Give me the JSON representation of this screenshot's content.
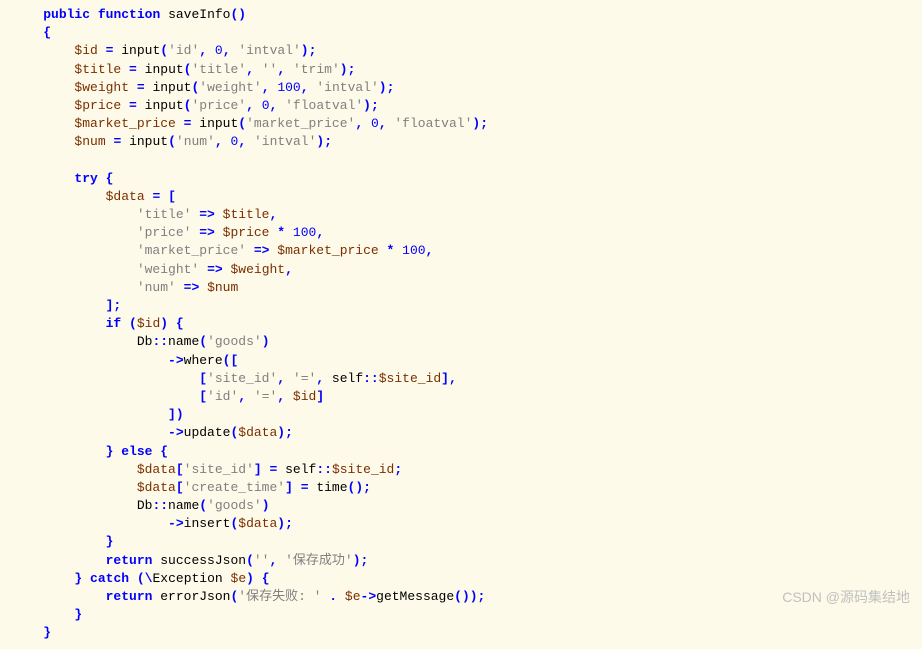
{
  "code": {
    "lines": [
      {
        "indent": 1,
        "segments": [
          {
            "c": "kw",
            "t": "public"
          },
          {
            "c": "plain",
            "t": " "
          },
          {
            "c": "kw",
            "t": "function"
          },
          {
            "c": "plain",
            "t": " saveInfo"
          },
          {
            "c": "punct",
            "t": "()"
          }
        ]
      },
      {
        "indent": 1,
        "segments": [
          {
            "c": "punct",
            "t": "{"
          }
        ]
      },
      {
        "indent": 2,
        "segments": [
          {
            "c": "var",
            "t": "$id"
          },
          {
            "c": "plain",
            "t": " "
          },
          {
            "c": "op",
            "t": "="
          },
          {
            "c": "plain",
            "t": " input"
          },
          {
            "c": "punct",
            "t": "("
          },
          {
            "c": "str",
            "t": "'id'"
          },
          {
            "c": "punct",
            "t": ","
          },
          {
            "c": "plain",
            "t": " "
          },
          {
            "c": "num",
            "t": "0"
          },
          {
            "c": "punct",
            "t": ","
          },
          {
            "c": "plain",
            "t": " "
          },
          {
            "c": "str",
            "t": "'intval'"
          },
          {
            "c": "punct",
            "t": ");"
          }
        ]
      },
      {
        "indent": 2,
        "segments": [
          {
            "c": "var",
            "t": "$title"
          },
          {
            "c": "plain",
            "t": " "
          },
          {
            "c": "op",
            "t": "="
          },
          {
            "c": "plain",
            "t": " input"
          },
          {
            "c": "punct",
            "t": "("
          },
          {
            "c": "str",
            "t": "'title'"
          },
          {
            "c": "punct",
            "t": ","
          },
          {
            "c": "plain",
            "t": " "
          },
          {
            "c": "str",
            "t": "''"
          },
          {
            "c": "punct",
            "t": ","
          },
          {
            "c": "plain",
            "t": " "
          },
          {
            "c": "str",
            "t": "'trim'"
          },
          {
            "c": "punct",
            "t": ");"
          }
        ]
      },
      {
        "indent": 2,
        "segments": [
          {
            "c": "var",
            "t": "$weight"
          },
          {
            "c": "plain",
            "t": " "
          },
          {
            "c": "op",
            "t": "="
          },
          {
            "c": "plain",
            "t": " input"
          },
          {
            "c": "punct",
            "t": "("
          },
          {
            "c": "str",
            "t": "'weight'"
          },
          {
            "c": "punct",
            "t": ","
          },
          {
            "c": "plain",
            "t": " "
          },
          {
            "c": "num",
            "t": "100"
          },
          {
            "c": "punct",
            "t": ","
          },
          {
            "c": "plain",
            "t": " "
          },
          {
            "c": "str",
            "t": "'intval'"
          },
          {
            "c": "punct",
            "t": ");"
          }
        ]
      },
      {
        "indent": 2,
        "segments": [
          {
            "c": "var",
            "t": "$price"
          },
          {
            "c": "plain",
            "t": " "
          },
          {
            "c": "op",
            "t": "="
          },
          {
            "c": "plain",
            "t": " input"
          },
          {
            "c": "punct",
            "t": "("
          },
          {
            "c": "str",
            "t": "'price'"
          },
          {
            "c": "punct",
            "t": ","
          },
          {
            "c": "plain",
            "t": " "
          },
          {
            "c": "num",
            "t": "0"
          },
          {
            "c": "punct",
            "t": ","
          },
          {
            "c": "plain",
            "t": " "
          },
          {
            "c": "str",
            "t": "'floatval'"
          },
          {
            "c": "punct",
            "t": ");"
          }
        ]
      },
      {
        "indent": 2,
        "segments": [
          {
            "c": "var",
            "t": "$market_price"
          },
          {
            "c": "plain",
            "t": " "
          },
          {
            "c": "op",
            "t": "="
          },
          {
            "c": "plain",
            "t": " input"
          },
          {
            "c": "punct",
            "t": "("
          },
          {
            "c": "str",
            "t": "'market_price'"
          },
          {
            "c": "punct",
            "t": ","
          },
          {
            "c": "plain",
            "t": " "
          },
          {
            "c": "num",
            "t": "0"
          },
          {
            "c": "punct",
            "t": ","
          },
          {
            "c": "plain",
            "t": " "
          },
          {
            "c": "str",
            "t": "'floatval'"
          },
          {
            "c": "punct",
            "t": ");"
          }
        ]
      },
      {
        "indent": 2,
        "segments": [
          {
            "c": "var",
            "t": "$num"
          },
          {
            "c": "plain",
            "t": " "
          },
          {
            "c": "op",
            "t": "="
          },
          {
            "c": "plain",
            "t": " input"
          },
          {
            "c": "punct",
            "t": "("
          },
          {
            "c": "str",
            "t": "'num'"
          },
          {
            "c": "punct",
            "t": ","
          },
          {
            "c": "plain",
            "t": " "
          },
          {
            "c": "num",
            "t": "0"
          },
          {
            "c": "punct",
            "t": ","
          },
          {
            "c": "plain",
            "t": " "
          },
          {
            "c": "str",
            "t": "'intval'"
          },
          {
            "c": "punct",
            "t": ");"
          }
        ]
      },
      {
        "indent": 0,
        "segments": []
      },
      {
        "indent": 2,
        "segments": [
          {
            "c": "kw",
            "t": "try"
          },
          {
            "c": "plain",
            "t": " "
          },
          {
            "c": "punct",
            "t": "{"
          }
        ]
      },
      {
        "indent": 3,
        "segments": [
          {
            "c": "var",
            "t": "$data"
          },
          {
            "c": "plain",
            "t": " "
          },
          {
            "c": "op",
            "t": "="
          },
          {
            "c": "plain",
            "t": " "
          },
          {
            "c": "punct",
            "t": "["
          }
        ]
      },
      {
        "indent": 4,
        "segments": [
          {
            "c": "str",
            "t": "'title'"
          },
          {
            "c": "plain",
            "t": " "
          },
          {
            "c": "op",
            "t": "=>"
          },
          {
            "c": "plain",
            "t": " "
          },
          {
            "c": "var",
            "t": "$title"
          },
          {
            "c": "punct",
            "t": ","
          }
        ]
      },
      {
        "indent": 4,
        "segments": [
          {
            "c": "str",
            "t": "'price'"
          },
          {
            "c": "plain",
            "t": " "
          },
          {
            "c": "op",
            "t": "=>"
          },
          {
            "c": "plain",
            "t": " "
          },
          {
            "c": "var",
            "t": "$price"
          },
          {
            "c": "plain",
            "t": " "
          },
          {
            "c": "op",
            "t": "*"
          },
          {
            "c": "plain",
            "t": " "
          },
          {
            "c": "num",
            "t": "100"
          },
          {
            "c": "punct",
            "t": ","
          }
        ]
      },
      {
        "indent": 4,
        "segments": [
          {
            "c": "str",
            "t": "'market_price'"
          },
          {
            "c": "plain",
            "t": " "
          },
          {
            "c": "op",
            "t": "=>"
          },
          {
            "c": "plain",
            "t": " "
          },
          {
            "c": "var",
            "t": "$market_price"
          },
          {
            "c": "plain",
            "t": " "
          },
          {
            "c": "op",
            "t": "*"
          },
          {
            "c": "plain",
            "t": " "
          },
          {
            "c": "num",
            "t": "100"
          },
          {
            "c": "punct",
            "t": ","
          }
        ]
      },
      {
        "indent": 4,
        "segments": [
          {
            "c": "str",
            "t": "'weight'"
          },
          {
            "c": "plain",
            "t": " "
          },
          {
            "c": "op",
            "t": "=>"
          },
          {
            "c": "plain",
            "t": " "
          },
          {
            "c": "var",
            "t": "$weight"
          },
          {
            "c": "punct",
            "t": ","
          }
        ]
      },
      {
        "indent": 4,
        "segments": [
          {
            "c": "str",
            "t": "'num'"
          },
          {
            "c": "plain",
            "t": " "
          },
          {
            "c": "op",
            "t": "=>"
          },
          {
            "c": "plain",
            "t": " "
          },
          {
            "c": "var",
            "t": "$num"
          }
        ]
      },
      {
        "indent": 3,
        "segments": [
          {
            "c": "punct",
            "t": "];"
          }
        ]
      },
      {
        "indent": 3,
        "segments": [
          {
            "c": "kw",
            "t": "if"
          },
          {
            "c": "plain",
            "t": " "
          },
          {
            "c": "punct",
            "t": "("
          },
          {
            "c": "var",
            "t": "$id"
          },
          {
            "c": "punct",
            "t": ")"
          },
          {
            "c": "plain",
            "t": " "
          },
          {
            "c": "punct",
            "t": "{"
          }
        ]
      },
      {
        "indent": 4,
        "segments": [
          {
            "c": "plain",
            "t": "Db"
          },
          {
            "c": "op",
            "t": "::"
          },
          {
            "c": "plain",
            "t": "name"
          },
          {
            "c": "punct",
            "t": "("
          },
          {
            "c": "str",
            "t": "'goods'"
          },
          {
            "c": "punct",
            "t": ")"
          }
        ]
      },
      {
        "indent": 5,
        "segments": [
          {
            "c": "op",
            "t": "->"
          },
          {
            "c": "plain",
            "t": "where"
          },
          {
            "c": "punct",
            "t": "(["
          }
        ]
      },
      {
        "indent": 6,
        "segments": [
          {
            "c": "punct",
            "t": "["
          },
          {
            "c": "str",
            "t": "'site_id'"
          },
          {
            "c": "punct",
            "t": ","
          },
          {
            "c": "plain",
            "t": " "
          },
          {
            "c": "str",
            "t": "'='"
          },
          {
            "c": "punct",
            "t": ","
          },
          {
            "c": "plain",
            "t": " self"
          },
          {
            "c": "op",
            "t": "::"
          },
          {
            "c": "var",
            "t": "$site_id"
          },
          {
            "c": "punct",
            "t": "],"
          }
        ]
      },
      {
        "indent": 6,
        "segments": [
          {
            "c": "punct",
            "t": "["
          },
          {
            "c": "str",
            "t": "'id'"
          },
          {
            "c": "punct",
            "t": ","
          },
          {
            "c": "plain",
            "t": " "
          },
          {
            "c": "str",
            "t": "'='"
          },
          {
            "c": "punct",
            "t": ","
          },
          {
            "c": "plain",
            "t": " "
          },
          {
            "c": "var",
            "t": "$id"
          },
          {
            "c": "punct",
            "t": "]"
          }
        ]
      },
      {
        "indent": 5,
        "segments": [
          {
            "c": "punct",
            "t": "])"
          }
        ]
      },
      {
        "indent": 5,
        "segments": [
          {
            "c": "op",
            "t": "->"
          },
          {
            "c": "plain",
            "t": "update"
          },
          {
            "c": "punct",
            "t": "("
          },
          {
            "c": "var",
            "t": "$data"
          },
          {
            "c": "punct",
            "t": ");"
          }
        ]
      },
      {
        "indent": 3,
        "segments": [
          {
            "c": "punct",
            "t": "}"
          },
          {
            "c": "plain",
            "t": " "
          },
          {
            "c": "kw",
            "t": "else"
          },
          {
            "c": "plain",
            "t": " "
          },
          {
            "c": "punct",
            "t": "{"
          }
        ]
      },
      {
        "indent": 4,
        "segments": [
          {
            "c": "var",
            "t": "$data"
          },
          {
            "c": "punct",
            "t": "["
          },
          {
            "c": "str",
            "t": "'site_id'"
          },
          {
            "c": "punct",
            "t": "]"
          },
          {
            "c": "plain",
            "t": " "
          },
          {
            "c": "op",
            "t": "="
          },
          {
            "c": "plain",
            "t": " self"
          },
          {
            "c": "op",
            "t": "::"
          },
          {
            "c": "var",
            "t": "$site_id"
          },
          {
            "c": "punct",
            "t": ";"
          }
        ]
      },
      {
        "indent": 4,
        "segments": [
          {
            "c": "var",
            "t": "$data"
          },
          {
            "c": "punct",
            "t": "["
          },
          {
            "c": "str",
            "t": "'create_time'"
          },
          {
            "c": "punct",
            "t": "]"
          },
          {
            "c": "plain",
            "t": " "
          },
          {
            "c": "op",
            "t": "="
          },
          {
            "c": "plain",
            "t": " time"
          },
          {
            "c": "punct",
            "t": "();"
          }
        ]
      },
      {
        "indent": 4,
        "segments": [
          {
            "c": "plain",
            "t": "Db"
          },
          {
            "c": "op",
            "t": "::"
          },
          {
            "c": "plain",
            "t": "name"
          },
          {
            "c": "punct",
            "t": "("
          },
          {
            "c": "str",
            "t": "'goods'"
          },
          {
            "c": "punct",
            "t": ")"
          }
        ]
      },
      {
        "indent": 5,
        "segments": [
          {
            "c": "op",
            "t": "->"
          },
          {
            "c": "plain",
            "t": "insert"
          },
          {
            "c": "punct",
            "t": "("
          },
          {
            "c": "var",
            "t": "$data"
          },
          {
            "c": "punct",
            "t": ");"
          }
        ]
      },
      {
        "indent": 3,
        "segments": [
          {
            "c": "punct",
            "t": "}"
          }
        ]
      },
      {
        "indent": 3,
        "segments": [
          {
            "c": "kw",
            "t": "return"
          },
          {
            "c": "plain",
            "t": " successJson"
          },
          {
            "c": "punct",
            "t": "("
          },
          {
            "c": "str",
            "t": "''"
          },
          {
            "c": "punct",
            "t": ","
          },
          {
            "c": "plain",
            "t": " "
          },
          {
            "c": "str",
            "t": "'保存成功'"
          },
          {
            "c": "punct",
            "t": ");"
          }
        ]
      },
      {
        "indent": 2,
        "segments": [
          {
            "c": "punct",
            "t": "}"
          },
          {
            "c": "plain",
            "t": " "
          },
          {
            "c": "kw",
            "t": "catch"
          },
          {
            "c": "plain",
            "t": " "
          },
          {
            "c": "punct",
            "t": "("
          },
          {
            "c": "op",
            "t": "\\"
          },
          {
            "c": "plain",
            "t": "Exception "
          },
          {
            "c": "var",
            "t": "$e"
          },
          {
            "c": "punct",
            "t": ")"
          },
          {
            "c": "plain",
            "t": " "
          },
          {
            "c": "punct",
            "t": "{"
          }
        ]
      },
      {
        "indent": 3,
        "segments": [
          {
            "c": "kw",
            "t": "return"
          },
          {
            "c": "plain",
            "t": " errorJson"
          },
          {
            "c": "punct",
            "t": "("
          },
          {
            "c": "str",
            "t": "'保存失败: '"
          },
          {
            "c": "plain",
            "t": " "
          },
          {
            "c": "op",
            "t": "."
          },
          {
            "c": "plain",
            "t": " "
          },
          {
            "c": "var",
            "t": "$e"
          },
          {
            "c": "op",
            "t": "->"
          },
          {
            "c": "plain",
            "t": "getMessage"
          },
          {
            "c": "punct",
            "t": "());"
          }
        ]
      },
      {
        "indent": 2,
        "segments": [
          {
            "c": "punct",
            "t": "}"
          }
        ]
      },
      {
        "indent": 1,
        "segments": [
          {
            "c": "punct",
            "t": "}"
          }
        ]
      }
    ]
  },
  "watermark": "CSDN @源码集结地"
}
